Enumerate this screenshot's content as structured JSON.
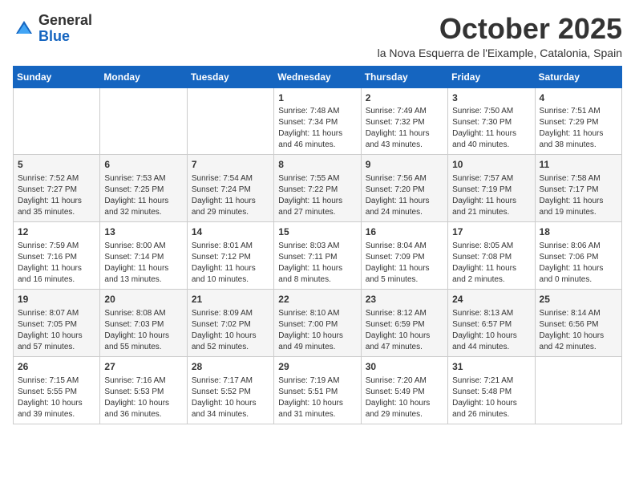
{
  "header": {
    "logo": {
      "general": "General",
      "blue": "Blue"
    },
    "title": "October 2025",
    "location": "la Nova Esquerra de l'Eixample, Catalonia, Spain"
  },
  "days_of_week": [
    "Sunday",
    "Monday",
    "Tuesday",
    "Wednesday",
    "Thursday",
    "Friday",
    "Saturday"
  ],
  "weeks": [
    [
      {
        "day": "",
        "info": ""
      },
      {
        "day": "",
        "info": ""
      },
      {
        "day": "",
        "info": ""
      },
      {
        "day": "1",
        "info": "Sunrise: 7:48 AM\nSunset: 7:34 PM\nDaylight: 11 hours and 46 minutes."
      },
      {
        "day": "2",
        "info": "Sunrise: 7:49 AM\nSunset: 7:32 PM\nDaylight: 11 hours and 43 minutes."
      },
      {
        "day": "3",
        "info": "Sunrise: 7:50 AM\nSunset: 7:30 PM\nDaylight: 11 hours and 40 minutes."
      },
      {
        "day": "4",
        "info": "Sunrise: 7:51 AM\nSunset: 7:29 PM\nDaylight: 11 hours and 38 minutes."
      }
    ],
    [
      {
        "day": "5",
        "info": "Sunrise: 7:52 AM\nSunset: 7:27 PM\nDaylight: 11 hours and 35 minutes."
      },
      {
        "day": "6",
        "info": "Sunrise: 7:53 AM\nSunset: 7:25 PM\nDaylight: 11 hours and 32 minutes."
      },
      {
        "day": "7",
        "info": "Sunrise: 7:54 AM\nSunset: 7:24 PM\nDaylight: 11 hours and 29 minutes."
      },
      {
        "day": "8",
        "info": "Sunrise: 7:55 AM\nSunset: 7:22 PM\nDaylight: 11 hours and 27 minutes."
      },
      {
        "day": "9",
        "info": "Sunrise: 7:56 AM\nSunset: 7:20 PM\nDaylight: 11 hours and 24 minutes."
      },
      {
        "day": "10",
        "info": "Sunrise: 7:57 AM\nSunset: 7:19 PM\nDaylight: 11 hours and 21 minutes."
      },
      {
        "day": "11",
        "info": "Sunrise: 7:58 AM\nSunset: 7:17 PM\nDaylight: 11 hours and 19 minutes."
      }
    ],
    [
      {
        "day": "12",
        "info": "Sunrise: 7:59 AM\nSunset: 7:16 PM\nDaylight: 11 hours and 16 minutes."
      },
      {
        "day": "13",
        "info": "Sunrise: 8:00 AM\nSunset: 7:14 PM\nDaylight: 11 hours and 13 minutes."
      },
      {
        "day": "14",
        "info": "Sunrise: 8:01 AM\nSunset: 7:12 PM\nDaylight: 11 hours and 10 minutes."
      },
      {
        "day": "15",
        "info": "Sunrise: 8:03 AM\nSunset: 7:11 PM\nDaylight: 11 hours and 8 minutes."
      },
      {
        "day": "16",
        "info": "Sunrise: 8:04 AM\nSunset: 7:09 PM\nDaylight: 11 hours and 5 minutes."
      },
      {
        "day": "17",
        "info": "Sunrise: 8:05 AM\nSunset: 7:08 PM\nDaylight: 11 hours and 2 minutes."
      },
      {
        "day": "18",
        "info": "Sunrise: 8:06 AM\nSunset: 7:06 PM\nDaylight: 11 hours and 0 minutes."
      }
    ],
    [
      {
        "day": "19",
        "info": "Sunrise: 8:07 AM\nSunset: 7:05 PM\nDaylight: 10 hours and 57 minutes."
      },
      {
        "day": "20",
        "info": "Sunrise: 8:08 AM\nSunset: 7:03 PM\nDaylight: 10 hours and 55 minutes."
      },
      {
        "day": "21",
        "info": "Sunrise: 8:09 AM\nSunset: 7:02 PM\nDaylight: 10 hours and 52 minutes."
      },
      {
        "day": "22",
        "info": "Sunrise: 8:10 AM\nSunset: 7:00 PM\nDaylight: 10 hours and 49 minutes."
      },
      {
        "day": "23",
        "info": "Sunrise: 8:12 AM\nSunset: 6:59 PM\nDaylight: 10 hours and 47 minutes."
      },
      {
        "day": "24",
        "info": "Sunrise: 8:13 AM\nSunset: 6:57 PM\nDaylight: 10 hours and 44 minutes."
      },
      {
        "day": "25",
        "info": "Sunrise: 8:14 AM\nSunset: 6:56 PM\nDaylight: 10 hours and 42 minutes."
      }
    ],
    [
      {
        "day": "26",
        "info": "Sunrise: 7:15 AM\nSunset: 5:55 PM\nDaylight: 10 hours and 39 minutes."
      },
      {
        "day": "27",
        "info": "Sunrise: 7:16 AM\nSunset: 5:53 PM\nDaylight: 10 hours and 36 minutes."
      },
      {
        "day": "28",
        "info": "Sunrise: 7:17 AM\nSunset: 5:52 PM\nDaylight: 10 hours and 34 minutes."
      },
      {
        "day": "29",
        "info": "Sunrise: 7:19 AM\nSunset: 5:51 PM\nDaylight: 10 hours and 31 minutes."
      },
      {
        "day": "30",
        "info": "Sunrise: 7:20 AM\nSunset: 5:49 PM\nDaylight: 10 hours and 29 minutes."
      },
      {
        "day": "31",
        "info": "Sunrise: 7:21 AM\nSunset: 5:48 PM\nDaylight: 10 hours and 26 minutes."
      },
      {
        "day": "",
        "info": ""
      }
    ]
  ]
}
